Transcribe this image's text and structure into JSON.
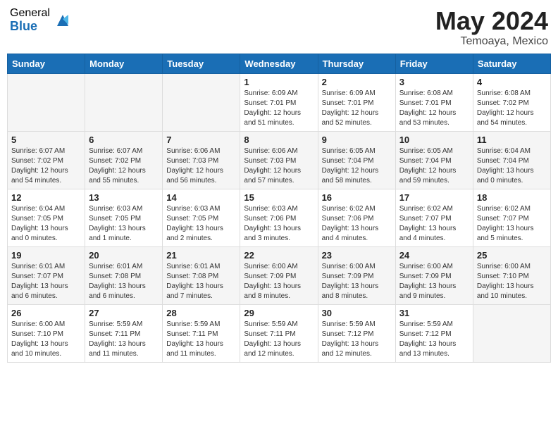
{
  "logo": {
    "general": "General",
    "blue": "Blue"
  },
  "title": {
    "month_year": "May 2024",
    "location": "Temoaya, Mexico"
  },
  "weekdays": [
    "Sunday",
    "Monday",
    "Tuesday",
    "Wednesday",
    "Thursday",
    "Friday",
    "Saturday"
  ],
  "weeks": [
    [
      {
        "day": "",
        "info": ""
      },
      {
        "day": "",
        "info": ""
      },
      {
        "day": "",
        "info": ""
      },
      {
        "day": "1",
        "info": "Sunrise: 6:09 AM\nSunset: 7:01 PM\nDaylight: 12 hours\nand 51 minutes."
      },
      {
        "day": "2",
        "info": "Sunrise: 6:09 AM\nSunset: 7:01 PM\nDaylight: 12 hours\nand 52 minutes."
      },
      {
        "day": "3",
        "info": "Sunrise: 6:08 AM\nSunset: 7:01 PM\nDaylight: 12 hours\nand 53 minutes."
      },
      {
        "day": "4",
        "info": "Sunrise: 6:08 AM\nSunset: 7:02 PM\nDaylight: 12 hours\nand 54 minutes."
      }
    ],
    [
      {
        "day": "5",
        "info": "Sunrise: 6:07 AM\nSunset: 7:02 PM\nDaylight: 12 hours\nand 54 minutes."
      },
      {
        "day": "6",
        "info": "Sunrise: 6:07 AM\nSunset: 7:02 PM\nDaylight: 12 hours\nand 55 minutes."
      },
      {
        "day": "7",
        "info": "Sunrise: 6:06 AM\nSunset: 7:03 PM\nDaylight: 12 hours\nand 56 minutes."
      },
      {
        "day": "8",
        "info": "Sunrise: 6:06 AM\nSunset: 7:03 PM\nDaylight: 12 hours\nand 57 minutes."
      },
      {
        "day": "9",
        "info": "Sunrise: 6:05 AM\nSunset: 7:04 PM\nDaylight: 12 hours\nand 58 minutes."
      },
      {
        "day": "10",
        "info": "Sunrise: 6:05 AM\nSunset: 7:04 PM\nDaylight: 12 hours\nand 59 minutes."
      },
      {
        "day": "11",
        "info": "Sunrise: 6:04 AM\nSunset: 7:04 PM\nDaylight: 13 hours\nand 0 minutes."
      }
    ],
    [
      {
        "day": "12",
        "info": "Sunrise: 6:04 AM\nSunset: 7:05 PM\nDaylight: 13 hours\nand 0 minutes."
      },
      {
        "day": "13",
        "info": "Sunrise: 6:03 AM\nSunset: 7:05 PM\nDaylight: 13 hours\nand 1 minute."
      },
      {
        "day": "14",
        "info": "Sunrise: 6:03 AM\nSunset: 7:05 PM\nDaylight: 13 hours\nand 2 minutes."
      },
      {
        "day": "15",
        "info": "Sunrise: 6:03 AM\nSunset: 7:06 PM\nDaylight: 13 hours\nand 3 minutes."
      },
      {
        "day": "16",
        "info": "Sunrise: 6:02 AM\nSunset: 7:06 PM\nDaylight: 13 hours\nand 4 minutes."
      },
      {
        "day": "17",
        "info": "Sunrise: 6:02 AM\nSunset: 7:07 PM\nDaylight: 13 hours\nand 4 minutes."
      },
      {
        "day": "18",
        "info": "Sunrise: 6:02 AM\nSunset: 7:07 PM\nDaylight: 13 hours\nand 5 minutes."
      }
    ],
    [
      {
        "day": "19",
        "info": "Sunrise: 6:01 AM\nSunset: 7:07 PM\nDaylight: 13 hours\nand 6 minutes."
      },
      {
        "day": "20",
        "info": "Sunrise: 6:01 AM\nSunset: 7:08 PM\nDaylight: 13 hours\nand 6 minutes."
      },
      {
        "day": "21",
        "info": "Sunrise: 6:01 AM\nSunset: 7:08 PM\nDaylight: 13 hours\nand 7 minutes."
      },
      {
        "day": "22",
        "info": "Sunrise: 6:00 AM\nSunset: 7:09 PM\nDaylight: 13 hours\nand 8 minutes."
      },
      {
        "day": "23",
        "info": "Sunrise: 6:00 AM\nSunset: 7:09 PM\nDaylight: 13 hours\nand 8 minutes."
      },
      {
        "day": "24",
        "info": "Sunrise: 6:00 AM\nSunset: 7:09 PM\nDaylight: 13 hours\nand 9 minutes."
      },
      {
        "day": "25",
        "info": "Sunrise: 6:00 AM\nSunset: 7:10 PM\nDaylight: 13 hours\nand 10 minutes."
      }
    ],
    [
      {
        "day": "26",
        "info": "Sunrise: 6:00 AM\nSunset: 7:10 PM\nDaylight: 13 hours\nand 10 minutes."
      },
      {
        "day": "27",
        "info": "Sunrise: 5:59 AM\nSunset: 7:11 PM\nDaylight: 13 hours\nand 11 minutes."
      },
      {
        "day": "28",
        "info": "Sunrise: 5:59 AM\nSunset: 7:11 PM\nDaylight: 13 hours\nand 11 minutes."
      },
      {
        "day": "29",
        "info": "Sunrise: 5:59 AM\nSunset: 7:11 PM\nDaylight: 13 hours\nand 12 minutes."
      },
      {
        "day": "30",
        "info": "Sunrise: 5:59 AM\nSunset: 7:12 PM\nDaylight: 13 hours\nand 12 minutes."
      },
      {
        "day": "31",
        "info": "Sunrise: 5:59 AM\nSunset: 7:12 PM\nDaylight: 13 hours\nand 13 minutes."
      },
      {
        "day": "",
        "info": ""
      }
    ]
  ]
}
